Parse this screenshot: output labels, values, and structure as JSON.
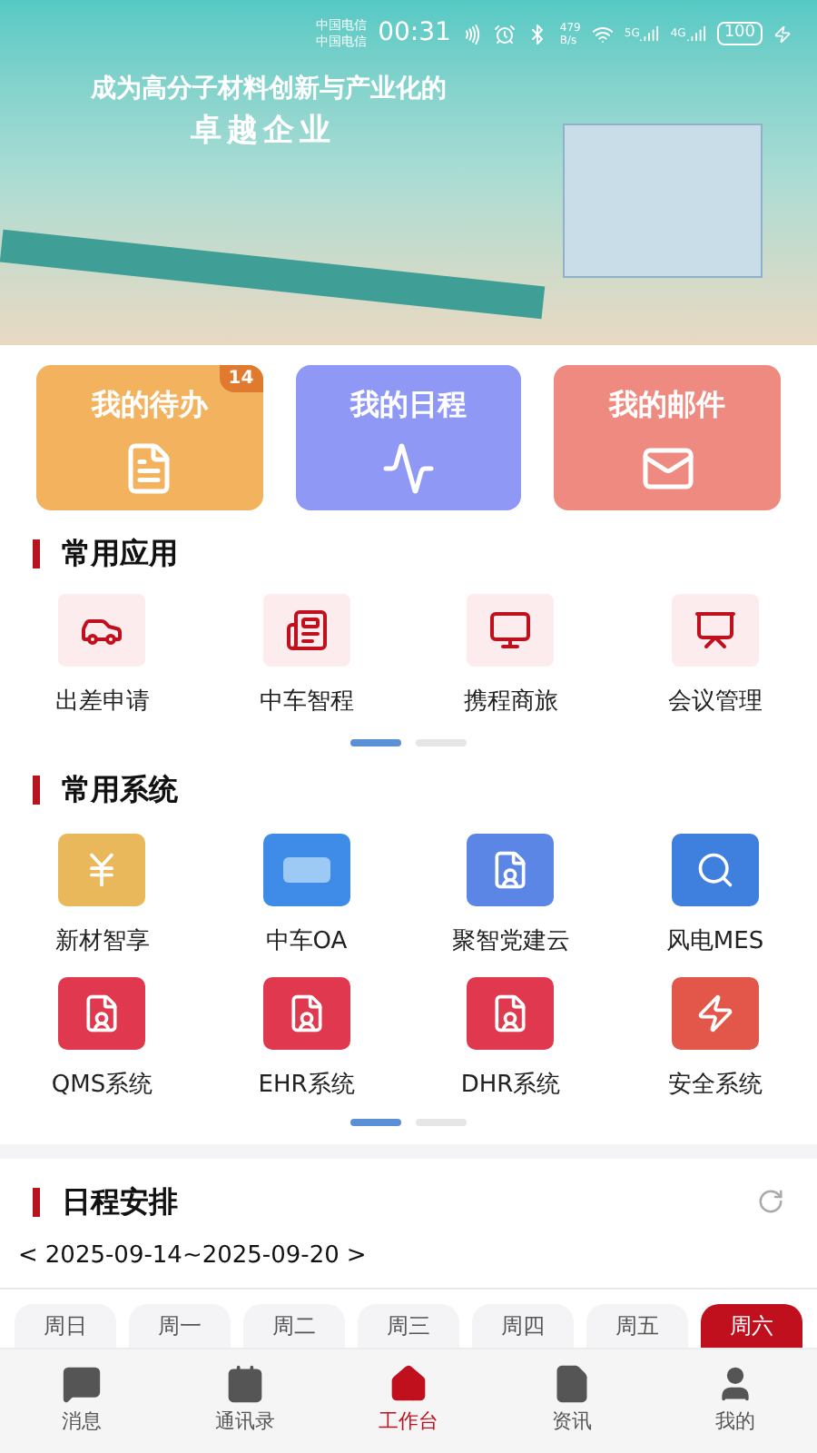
{
  "status_bar": {
    "carriers": [
      "中国电信",
      "中国电信"
    ],
    "time": "00:31",
    "net_speed": [
      "479",
      "B/s"
    ],
    "signals": [
      "5G",
      "4G"
    ],
    "battery": "100"
  },
  "banner": {
    "slogan": [
      "成为高分子材料创新与产业化的",
      "卓越企业"
    ]
  },
  "quick_cards": [
    {
      "kind": "todo",
      "label": "我的待办",
      "badge": "14",
      "color": "#f2b25e"
    },
    {
      "kind": "schedule",
      "label": "我的日程",
      "color": "#8f98f5"
    },
    {
      "kind": "mail",
      "label": "我的邮件",
      "color": "#ef8a80"
    }
  ],
  "common_apps": {
    "title": "常用应用",
    "items": [
      {
        "kind": "car",
        "label": "出差申请"
      },
      {
        "kind": "card",
        "label": "中车智程"
      },
      {
        "kind": "monitor",
        "label": "携程商旅"
      },
      {
        "kind": "board",
        "label": "会议管理"
      }
    ],
    "pages": [
      {
        "selected": true
      },
      {
        "selected": false
      }
    ]
  },
  "common_systems": {
    "title": "常用系统",
    "items": [
      {
        "kind": "coin",
        "label": "新材智享",
        "color": "#e9b85a"
      },
      {
        "kind": "oa",
        "label": "中车OA",
        "color": "#3f8ce8"
      },
      {
        "kind": "party",
        "label": "聚智党建云",
        "color": "#5c86e6"
      },
      {
        "kind": "search",
        "label": "风电MES",
        "color": "#3f7fde"
      },
      {
        "kind": "doc",
        "label": "QMS系统",
        "color": "#e0384f"
      },
      {
        "kind": "doc",
        "label": "EHR系统",
        "color": "#e0384f"
      },
      {
        "kind": "doc",
        "label": "DHR系统",
        "color": "#e0384f"
      },
      {
        "kind": "screen",
        "label": "安全系统",
        "color": "#e2574a"
      }
    ],
    "pages": [
      {
        "selected": true
      },
      {
        "selected": false
      }
    ]
  },
  "schedule": {
    "title": "日程安排",
    "prev": "<",
    "range": "2025-09-14~2025-09-20",
    "next": ">",
    "days": [
      {
        "label": "周日",
        "selected": false
      },
      {
        "label": "周一",
        "selected": false
      },
      {
        "label": "周二",
        "selected": false
      },
      {
        "label": "周三",
        "selected": false
      },
      {
        "label": "周四",
        "selected": false
      },
      {
        "label": "周五",
        "selected": false
      },
      {
        "label": "周六",
        "selected": true
      }
    ]
  },
  "nav": [
    {
      "kind": "chat",
      "label": "消息",
      "selected": false
    },
    {
      "kind": "contacts",
      "label": "通讯录",
      "selected": false
    },
    {
      "kind": "home",
      "label": "工作台",
      "selected": true
    },
    {
      "kind": "news",
      "label": "资讯",
      "selected": false
    },
    {
      "kind": "user",
      "label": "我的",
      "selected": false
    }
  ]
}
